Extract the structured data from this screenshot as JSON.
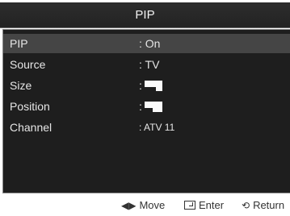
{
  "title": "PIP",
  "menu": [
    {
      "label": "PIP",
      "value": ": On"
    },
    {
      "label": "Source",
      "value": ": TV"
    },
    {
      "label": "Size",
      "value": ":"
    },
    {
      "label": "Position",
      "value": ":"
    },
    {
      "label": "Channel",
      "value": ": ATV 11"
    }
  ],
  "footer": {
    "move_icon": "left-right-arrows-icon",
    "move_label": "Move",
    "enter_icon": "enter-icon",
    "enter_label": "Enter",
    "return_icon": "return-icon",
    "return_label": "Return"
  }
}
